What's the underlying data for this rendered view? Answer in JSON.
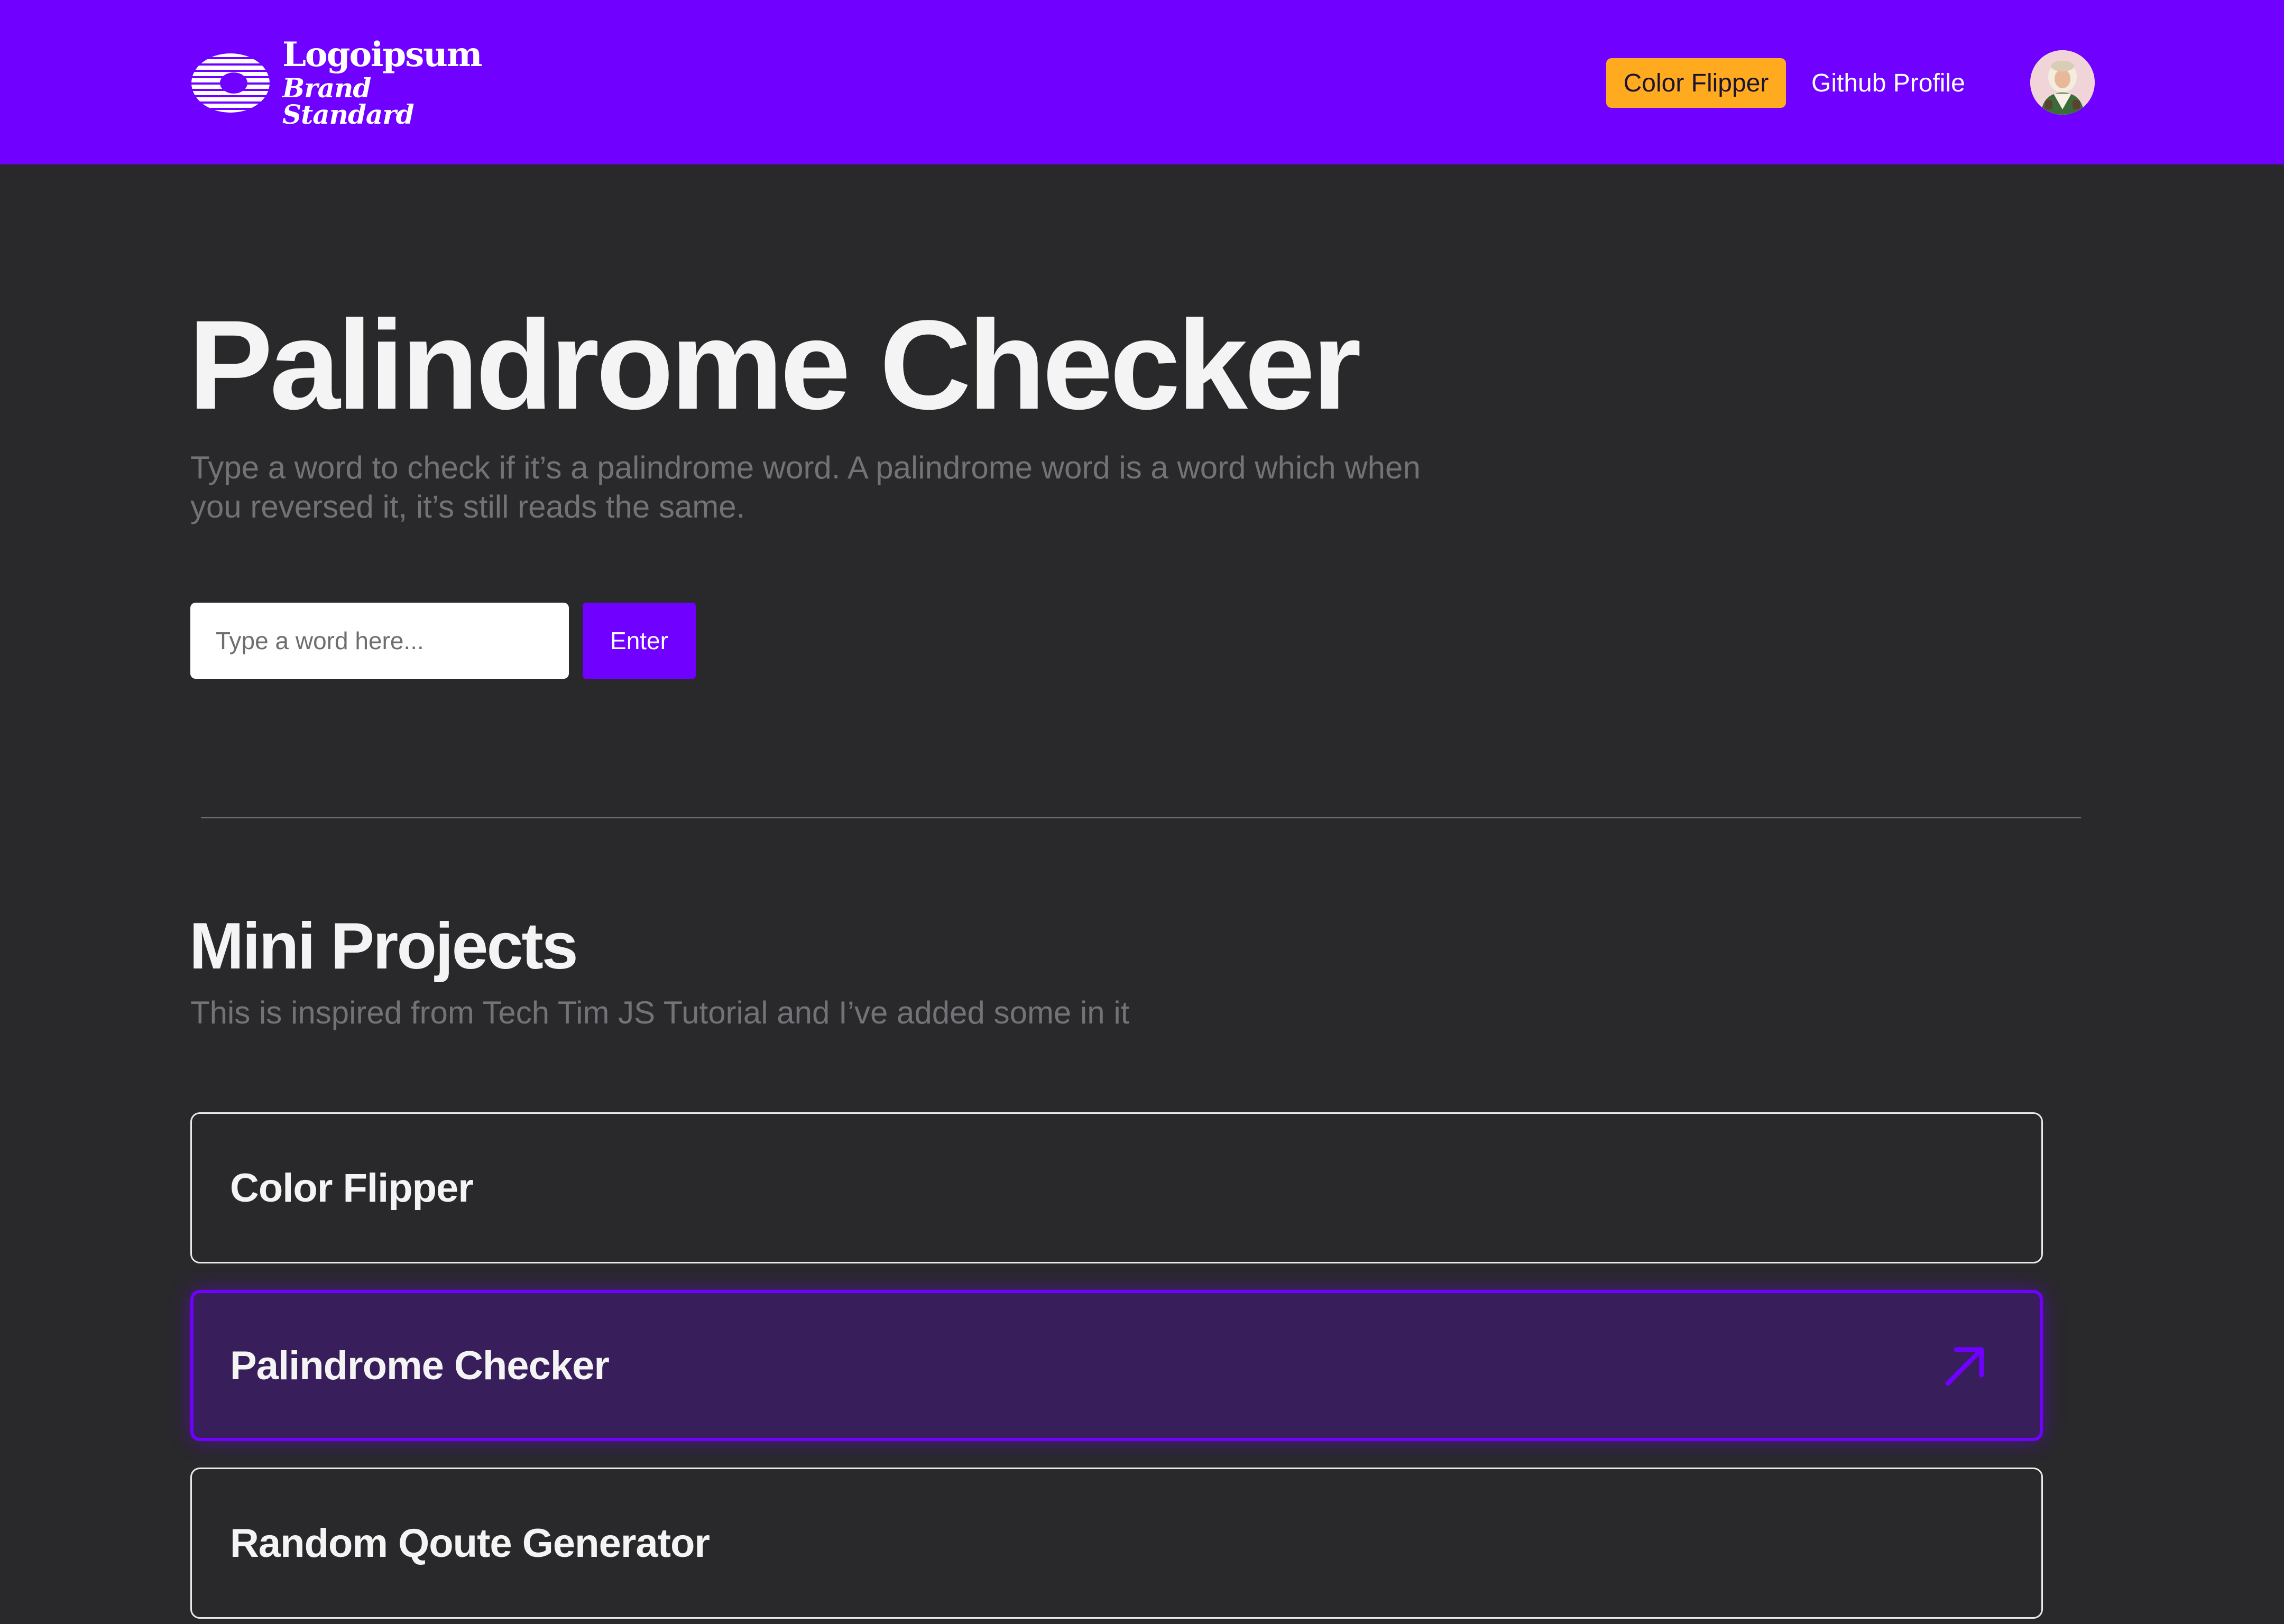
{
  "header": {
    "logo": {
      "name": "Logoipsum",
      "tagline": "Brand Standard"
    },
    "nav": {
      "color_flipper_label": "Color Flipper",
      "github_label": "Github Profile"
    },
    "colors": {
      "brand": "#7000ff",
      "nav_button": "#ffaa1f"
    },
    "avatar_icon": "user-avatar"
  },
  "hero": {
    "title": "Palindrome Checker",
    "description": "Type a word to check if it’s a palindrome word. A palindrome word is a word which when you reversed it, it’s still reads the same.",
    "input": {
      "placeholder": "Type a word here...",
      "value": ""
    },
    "enter_label": "Enter"
  },
  "projects": {
    "title": "Mini Projects",
    "description": "This is inspired from Tech Tim JS Tutorial and I’ve added some in it",
    "items": [
      {
        "label": "Color Flipper",
        "active": false
      },
      {
        "label": "Palindrome Checker",
        "active": true,
        "icon": "arrow-up-right-icon"
      },
      {
        "label": "Random Qoute Generator",
        "active": false
      }
    ]
  }
}
